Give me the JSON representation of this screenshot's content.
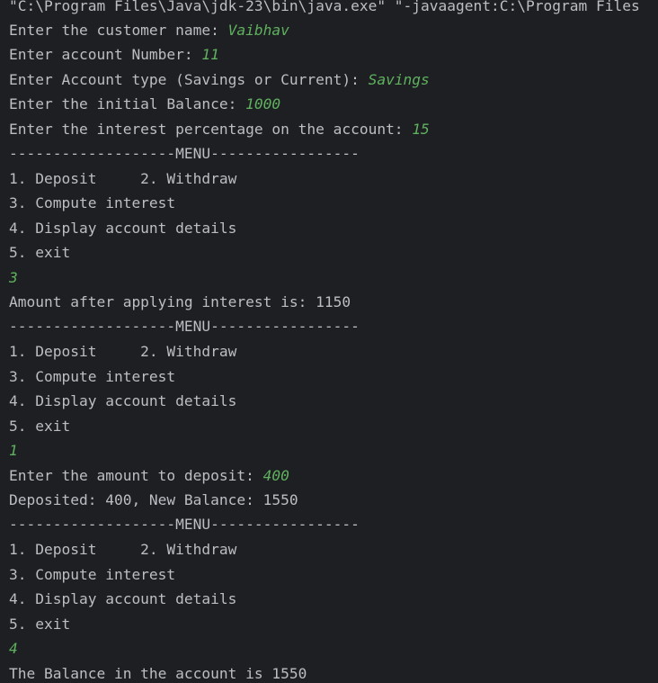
{
  "console": {
    "command_line": "\"C:\\Program Files\\Java\\jdk-23\\bin\\java.exe\" \"-javaagent:C:\\Program Files",
    "lines": [
      {
        "prompt": "Enter the customer name: ",
        "input": "Vaibhav"
      },
      {
        "prompt": "Enter account Number: ",
        "input": "11"
      },
      {
        "prompt": "Enter Account type (Savings or Current): ",
        "input": "Savings"
      },
      {
        "prompt": "Enter the initial Balance: ",
        "input": "1000"
      },
      {
        "prompt": "Enter the interest percentage on the account: ",
        "input": "15"
      },
      {
        "text": "-------------------MENU-----------------"
      },
      {
        "text": "1. Deposit     2. Withdraw"
      },
      {
        "text": "3. Compute interest"
      },
      {
        "text": "4. Display account details"
      },
      {
        "text": "5. exit"
      },
      {
        "input": "3"
      },
      {
        "text": "Amount after applying interest is: 1150"
      },
      {
        "text": "-------------------MENU-----------------"
      },
      {
        "text": "1. Deposit     2. Withdraw"
      },
      {
        "text": "3. Compute interest"
      },
      {
        "text": "4. Display account details"
      },
      {
        "text": "5. exit"
      },
      {
        "input": "1"
      },
      {
        "prompt": "Enter the amount to deposit: ",
        "input": "400"
      },
      {
        "text": "Deposited: 400, New Balance: 1550"
      },
      {
        "text": "-------------------MENU-----------------"
      },
      {
        "text": "1. Deposit     2. Withdraw"
      },
      {
        "text": "3. Compute interest"
      },
      {
        "text": "4. Display account details"
      },
      {
        "text": "5. exit"
      },
      {
        "input": "4"
      },
      {
        "text": "The Balance in the account is 1550"
      }
    ]
  },
  "colors": {
    "background": "#1e1f22",
    "output_text": "#bcbec4",
    "user_input": "#5fb15f"
  }
}
